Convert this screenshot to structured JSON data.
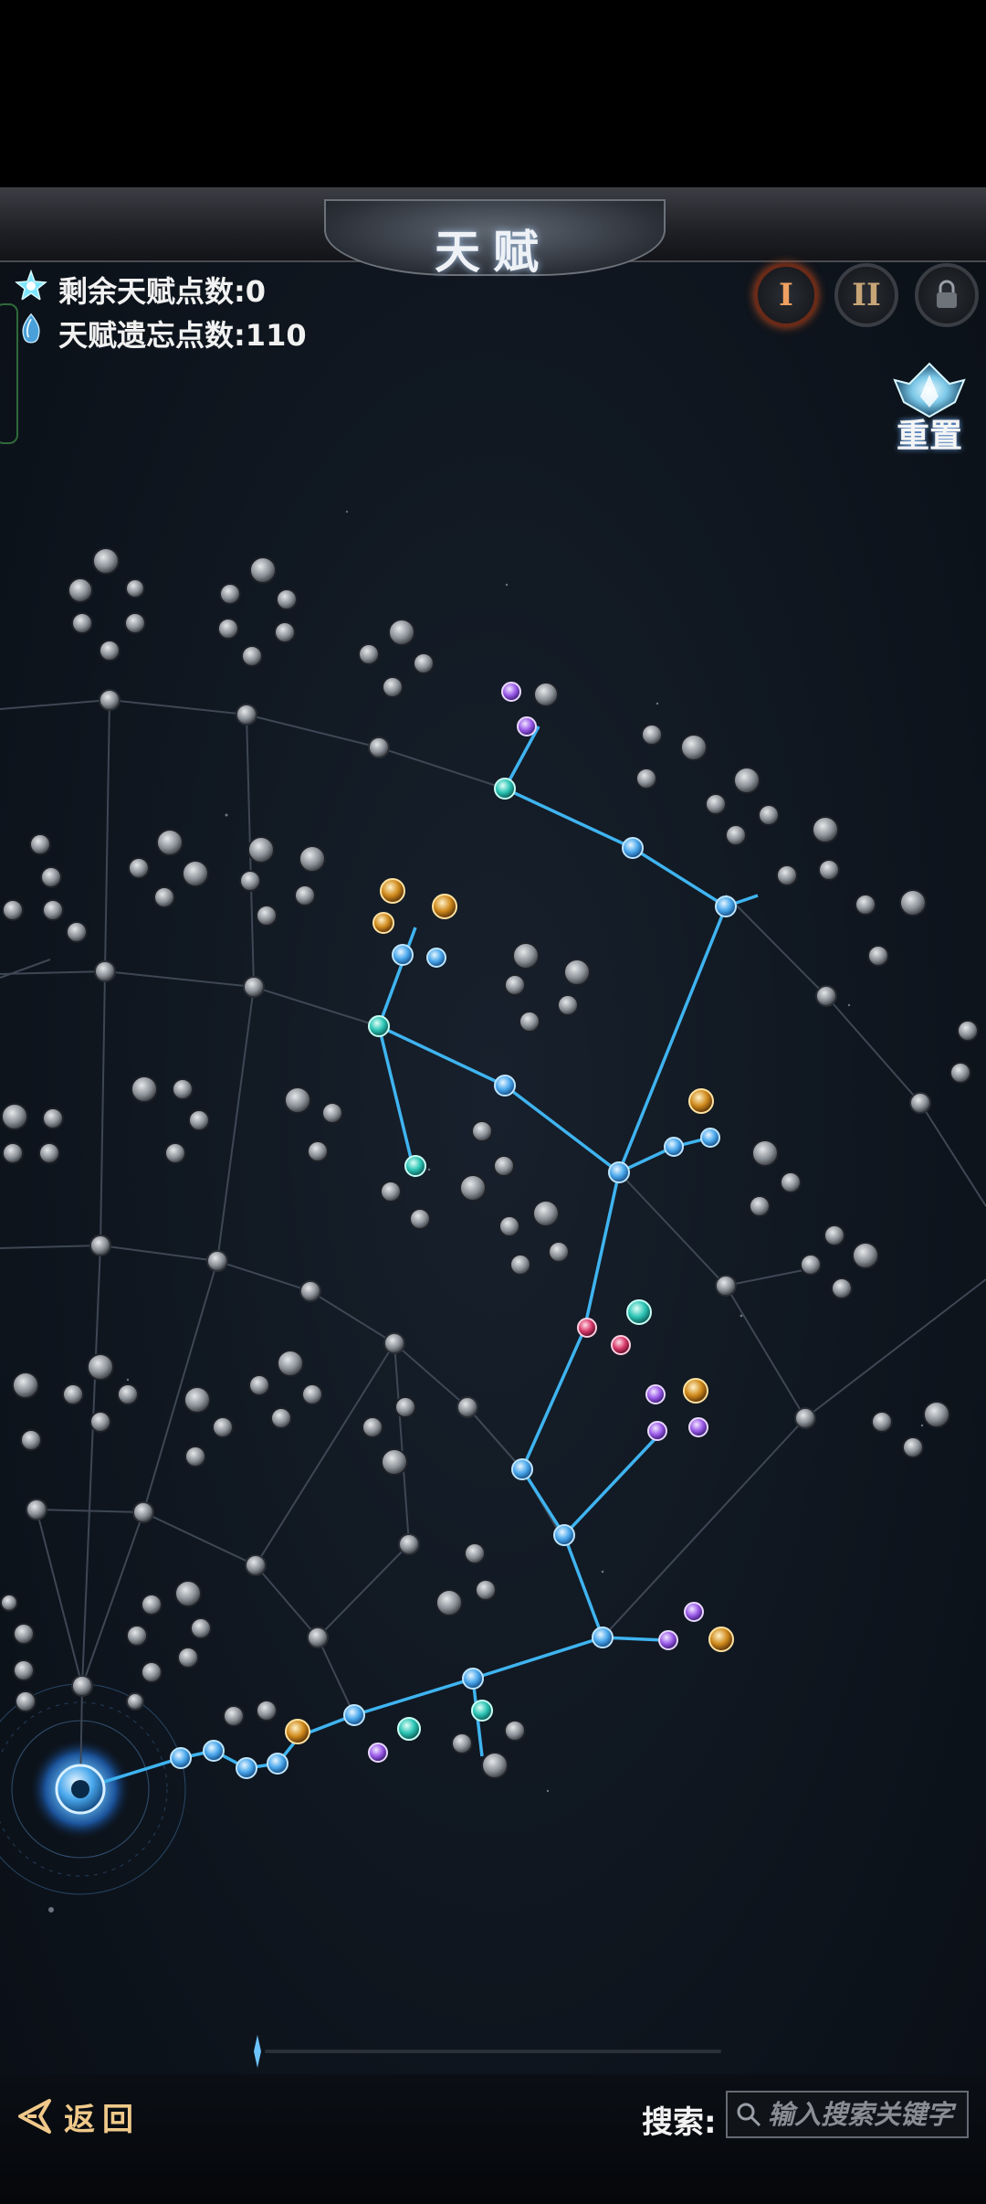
{
  "header": {
    "title": "天赋"
  },
  "stats": {
    "remaining_points_label": "剩余天赋点数:0",
    "forget_points_label": "天赋遗忘点数:110"
  },
  "toolbar": {
    "page1_label": "I",
    "page2_label": "II",
    "reset_label": "重置"
  },
  "footer": {
    "back_label": "返回",
    "search_label": "搜索:",
    "search_placeholder": "输入搜索关键字",
    "search_value": ""
  },
  "colors": {
    "active_line": "#3fb4f0",
    "inactive_line": "#3e4754",
    "active_node": "#5ab8ff",
    "inactive_node": "#8a8f96",
    "title_accent": "#9cb6d8"
  },
  "tree": {
    "active_path_nodes": 24,
    "root_node": "root-core-node"
  }
}
